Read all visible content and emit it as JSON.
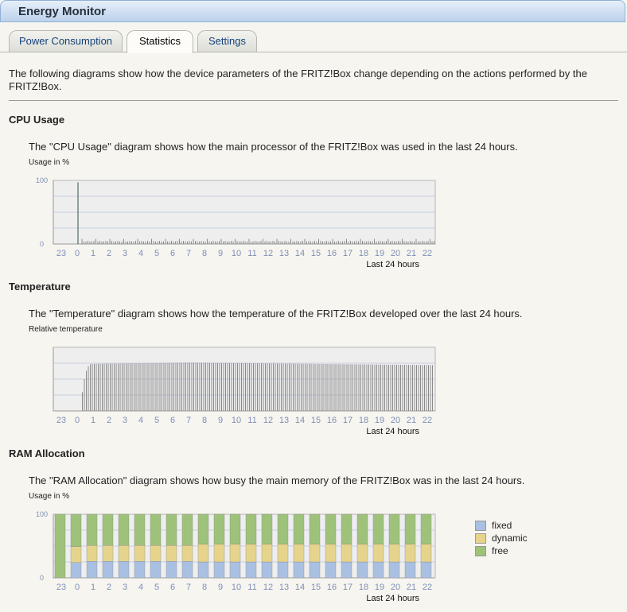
{
  "window": {
    "title": "Energy Monitor"
  },
  "tabs": [
    {
      "label": "Power Consumption",
      "active": false
    },
    {
      "label": "Statistics",
      "active": true
    },
    {
      "label": "Settings",
      "active": false
    }
  ],
  "intro": "The following diagrams show how the device parameters of the FRITZ!Box change depending on the actions performed by the FRITZ!Box.",
  "sections": {
    "cpu": {
      "heading": "CPU Usage",
      "description": "The \"CPU Usage\" diagram shows how the main processor of the FRITZ!Box was used in the last 24 hours.",
      "ylabel": "Usage in %"
    },
    "temperature": {
      "heading": "Temperature",
      "description": "The \"Temperature\" diagram shows how the temperature of the FRITZ!Box developed over the last 24 hours.",
      "ylabel": "Relative temperature"
    },
    "ram": {
      "heading": "RAM Allocation",
      "description": "The \"RAM Allocation\" diagram shows how busy the main memory of the FRITZ!Box was in the last 24 hours.",
      "ylabel": "Usage in %"
    }
  },
  "colors": {
    "plot_bg": "#eeeeee",
    "grid": "#c5cfe0",
    "bar": "#8a8a8a",
    "axis_text": "#7d8fb8",
    "fixed": "#a9c0e2",
    "dynamic": "#e6d48c",
    "free": "#9ec27a"
  },
  "chart_data": [
    {
      "type": "bar",
      "id": "cpu",
      "xlabel": "Last 24 hours",
      "ylabel": "Usage in %",
      "x_ticks": [
        "23",
        "0",
        "1",
        "2",
        "3",
        "4",
        "5",
        "6",
        "7",
        "8",
        "9",
        "10",
        "11",
        "12",
        "13",
        "14",
        "15",
        "16",
        "17",
        "18",
        "19",
        "20",
        "21",
        "22"
      ],
      "ylim": [
        0,
        100
      ],
      "y_ticks": [
        "0",
        "100"
      ],
      "spike": {
        "hour_offset": 1.55,
        "value": 97
      },
      "baseline": {
        "start_hour_offset": 1.8,
        "typical_value": 4,
        "max_value": 8
      }
    },
    {
      "type": "bar",
      "id": "temperature",
      "xlabel": "Last 24 hours",
      "ylabel": "Relative temperature",
      "x_ticks": [
        "23",
        "0",
        "1",
        "2",
        "3",
        "4",
        "5",
        "6",
        "7",
        "8",
        "9",
        "10",
        "11",
        "12",
        "13",
        "14",
        "15",
        "16",
        "17",
        "18",
        "19",
        "20",
        "21",
        "22"
      ],
      "ylim": [
        0,
        100
      ],
      "rise": {
        "start_hour_offset": 1.7,
        "full_hour_offset": 2.5
      },
      "level_start": 74,
      "level_peak": {
        "hour_offset": 8.5,
        "value": 76
      },
      "level_end": 72,
      "level_last": 76
    },
    {
      "type": "bar",
      "id": "ram",
      "stacked": true,
      "xlabel": "Last 24 hours",
      "ylabel": "Usage in %",
      "x_ticks": [
        "23",
        "0",
        "1",
        "2",
        "3",
        "4",
        "5",
        "6",
        "7",
        "8",
        "9",
        "10",
        "11",
        "12",
        "13",
        "14",
        "15",
        "16",
        "17",
        "18",
        "19",
        "20",
        "21",
        "22"
      ],
      "ylim": [
        0,
        100
      ],
      "y_ticks": [
        "0",
        "100"
      ],
      "series": [
        {
          "name": "fixed",
          "values": [
            0,
            24,
            26,
            26,
            26,
            26,
            26,
            26,
            26,
            25,
            25,
            25,
            25,
            25,
            25,
            25,
            25,
            25,
            25,
            25,
            25,
            25,
            25,
            25
          ]
        },
        {
          "name": "dynamic",
          "values": [
            0,
            25,
            25,
            25,
            25,
            25,
            25,
            25,
            25,
            28,
            28,
            28,
            28,
            28,
            28,
            28,
            28,
            28,
            28,
            28,
            28,
            28,
            28,
            28
          ]
        },
        {
          "name": "free",
          "values": [
            100,
            51,
            49,
            49,
            49,
            49,
            49,
            49,
            49,
            47,
            47,
            47,
            47,
            47,
            47,
            47,
            47,
            47,
            47,
            47,
            47,
            47,
            47,
            47
          ]
        }
      ],
      "legend": [
        "fixed",
        "dynamic",
        "free"
      ]
    }
  ]
}
